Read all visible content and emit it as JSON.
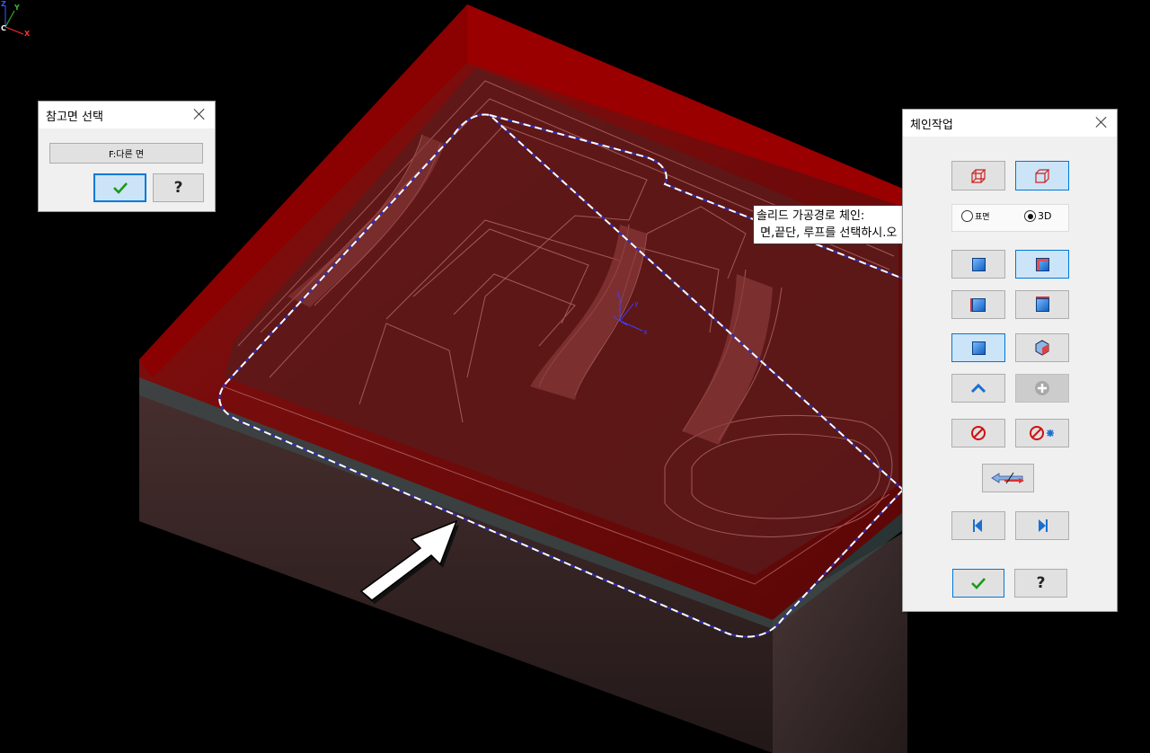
{
  "axis": {
    "z": "Z",
    "y": "Y",
    "c": "C",
    "x": "X"
  },
  "model_axis": {
    "z": "z",
    "y": "y",
    "x": "x"
  },
  "ref_dialog": {
    "title": "참고면 선택",
    "other_face_button": "F:다른 면"
  },
  "chain_dialog": {
    "title": "체인작업",
    "mode_options": [
      "표면",
      "3D"
    ],
    "selected_mode": "3D"
  },
  "tooltip": {
    "line1": "솔리드 가공경로 체인:",
    "line2": " 면,끝단, 루프를 선택하시.오"
  },
  "colors": {
    "mold_red": "#7a0000",
    "surface_dark": "#2e1f1f",
    "chain_outline": "#ffffff",
    "accent_blue": "#0078d7"
  },
  "icons": {
    "ok": "check-icon",
    "help": "question-icon",
    "close": "close-icon"
  }
}
